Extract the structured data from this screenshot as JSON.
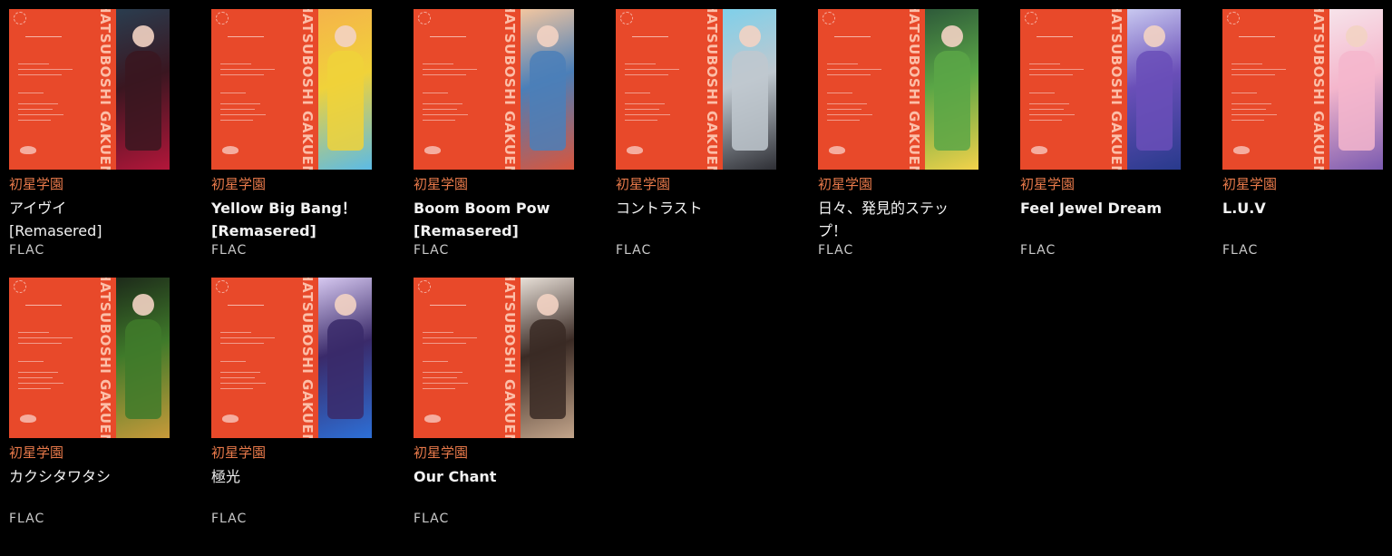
{
  "albums": [
    {
      "artist": "初星学園",
      "title": "アイヴイ\n[Remasered]",
      "format": "FLAC",
      "cover_text": "HATSUBOSHI GAKUEN",
      "art_colors": [
        "#3a1620",
        "#b3163a",
        "#2a3d4f"
      ],
      "title_style": "jp"
    },
    {
      "artist": "初星学園",
      "title": "Yellow Big Bang！\n[Remasered]",
      "format": "FLAC",
      "cover_text": "HATSUBOSHI GAKUEN",
      "art_colors": [
        "#f0d23a",
        "#5bbbe6",
        "#f5b34a"
      ],
      "title_style": "en"
    },
    {
      "artist": "初星学園",
      "title": "Boom Boom Pow\n[Remasered]",
      "format": "FLAC",
      "cover_text": "HATSUBOSHI GAKUEN",
      "art_colors": [
        "#4b7fb8",
        "#d9553c",
        "#f2c6a0"
      ],
      "title_style": "en"
    },
    {
      "artist": "初星学園",
      "title": "コントラスト",
      "format": "FLAC",
      "cover_text": "HATSUBOSHI GAKUEN",
      "art_colors": [
        "#bfc8cf",
        "#2e2f35",
        "#7fd0ea"
      ],
      "title_style": "jp"
    },
    {
      "artist": "初星学園",
      "title": "日々、発見的ステッ\nプ！",
      "format": "FLAC",
      "cover_text": "HATSUBOSHI GAKUEN",
      "art_colors": [
        "#5aa646",
        "#f2d24a",
        "#2e5a3a"
      ],
      "title_style": "jp"
    },
    {
      "artist": "初星学園",
      "title": "Feel Jewel Dream",
      "format": "FLAC",
      "cover_text": "HATSUBOSHI GAKUEN",
      "art_colors": [
        "#6a4fb8",
        "#283a8c",
        "#c8c8f0"
      ],
      "title_style": "en"
    },
    {
      "artist": "初星学園",
      "title": "L.U.V",
      "format": "FLAC",
      "cover_text": "HATSUBOSHI GAKUEN",
      "art_colors": [
        "#f4b6cc",
        "#7a5ab0",
        "#f7e3ea"
      ],
      "title_style": "en"
    },
    {
      "artist": "初星学園",
      "title": "カクシタワタシ",
      "format": "FLAC",
      "cover_text": "HATSUBOSHI GAKUEN",
      "art_colors": [
        "#3f7a2a",
        "#c89a3a",
        "#1d2a1a"
      ],
      "title_style": "jp"
    },
    {
      "artist": "初星学園",
      "title": "極光",
      "format": "FLAC",
      "cover_text": "HATSUBOSHI GAKUEN",
      "art_colors": [
        "#3a2a6a",
        "#2d6fd6",
        "#d6c8f0"
      ],
      "title_style": "jp"
    },
    {
      "artist": "初星学園",
      "title": "Our Chant",
      "format": "FLAC",
      "cover_text": "HATSUBOSHI GAKUEN",
      "art_colors": [
        "#3a2a24",
        "#c2a48a",
        "#e8e0d8"
      ],
      "title_style": "en"
    }
  ]
}
